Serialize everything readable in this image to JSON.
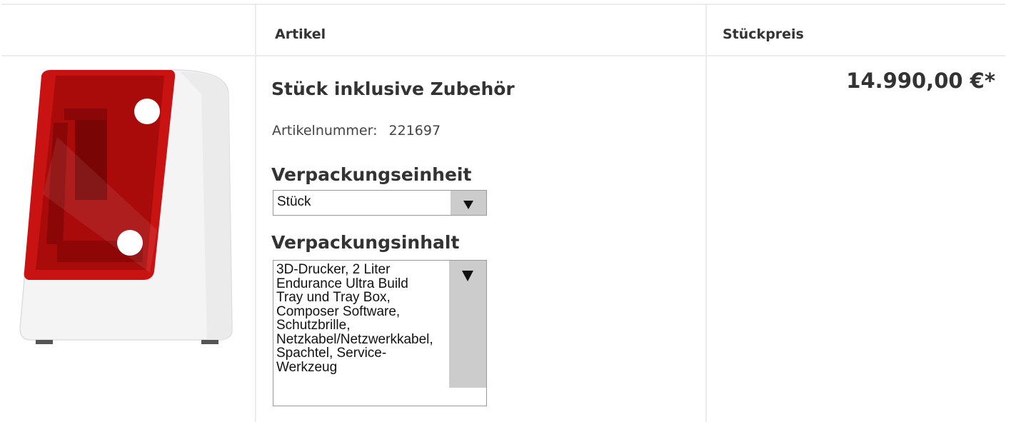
{
  "table": {
    "headers": [
      "",
      "Artikel",
      "Stückpreis"
    ]
  },
  "product": {
    "image_alt": "3D-Drucker",
    "title": "Stück inklusive Zubehör",
    "article_number_label": "Artikelnummer:",
    "article_number": "221697",
    "packaging_unit_label": "Verpackungseinheit",
    "packaging_unit_value": "Stück",
    "packaging_content_label": "Verpackungsinhalt",
    "packaging_content_value": "3D-Drucker, 2 Liter\nEndurance Ultra Build\nTray und Tray Box,\nComposer Software,\nSchutzbrille,\nNetzkabel/Netzwerkkabel,\nSpachtel, Service-\nWerkzeug",
    "price": "14.990,00 €*"
  },
  "icons": {
    "dropdown": "caret-down-icon"
  },
  "colors": {
    "printer_hood": "#c81010",
    "printer_body": "#f3f3f3",
    "dropdown_button": "#cccccc"
  }
}
